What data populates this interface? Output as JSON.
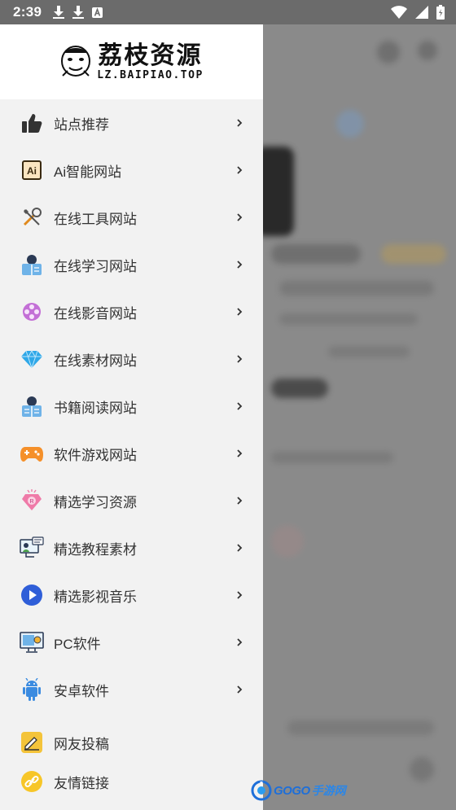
{
  "status_bar": {
    "time": "2:39"
  },
  "drawer": {
    "logo": {
      "title": "荔枝资源",
      "subtitle": "LZ.BAIPIAO.TOP"
    },
    "items": [
      {
        "label": "站点推荐",
        "icon": "thumbs-up-icon"
      },
      {
        "label": "Ai智能网站",
        "icon": "ai-icon"
      },
      {
        "label": "在线工具网站",
        "icon": "tools-icon"
      },
      {
        "label": "在线学习网站",
        "icon": "student-reading-icon"
      },
      {
        "label": "在线影音网站",
        "icon": "film-reel-icon"
      },
      {
        "label": "在线素材网站",
        "icon": "diamond-icon"
      },
      {
        "label": "书籍阅读网站",
        "icon": "book-reader-icon"
      },
      {
        "label": "软件游戏网站",
        "icon": "gamepad-icon"
      },
      {
        "label": "精选学习资源",
        "icon": "gem-badge-icon"
      },
      {
        "label": "精选教程素材",
        "icon": "tutorial-screen-icon"
      },
      {
        "label": "精选影视音乐",
        "icon": "play-circle-icon"
      },
      {
        "label": "PC软件",
        "icon": "pc-monitor-icon"
      },
      {
        "label": "安卓软件",
        "icon": "android-icon"
      }
    ],
    "extra_items": [
      {
        "label": "网友投稿",
        "icon": "submit-pen-icon"
      },
      {
        "label": "友情链接",
        "icon": "link-icon"
      }
    ]
  },
  "watermark": {
    "brand": "GOGO",
    "suffix": "手游网"
  },
  "colors": {
    "drawer_bg": "#f2f2f2",
    "scrim": "#7d7d7d",
    "accent_orange": "#f39c12",
    "accent_blue": "#2f6fe0"
  }
}
